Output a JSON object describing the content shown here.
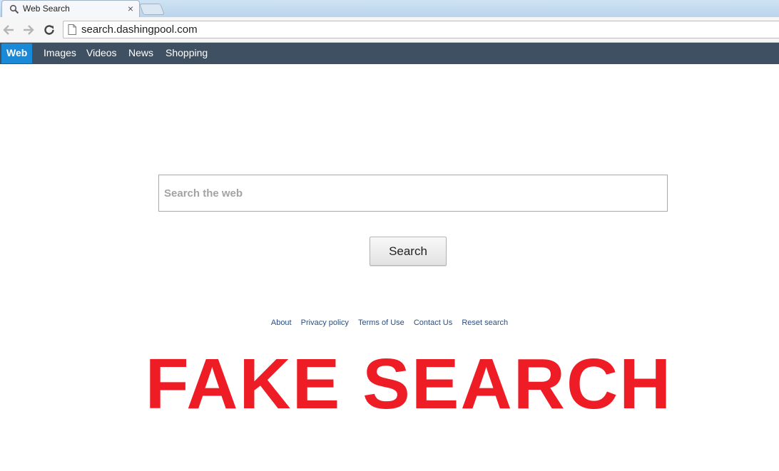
{
  "browser": {
    "tab_title": "Web Search",
    "tab_close": "×",
    "url": "search.dashingpool.com"
  },
  "navbar": {
    "items": [
      {
        "label": "Web",
        "active": true
      },
      {
        "label": "Images"
      },
      {
        "label": "Videos"
      },
      {
        "label": "News"
      },
      {
        "label": "Shopping"
      }
    ]
  },
  "search": {
    "placeholder": "Search the web",
    "button_label": "Search"
  },
  "footer": {
    "links": [
      "About",
      "Privacy policy",
      "Terms of Use",
      "Contact Us",
      "Reset search"
    ]
  },
  "overlay": {
    "text": "FAKE SEARCH",
    "color": "#ee1c25"
  },
  "colors": {
    "navbar_bg": "#3e5062",
    "active_tab": "#1a8ad8",
    "link": "#2b4e80"
  }
}
